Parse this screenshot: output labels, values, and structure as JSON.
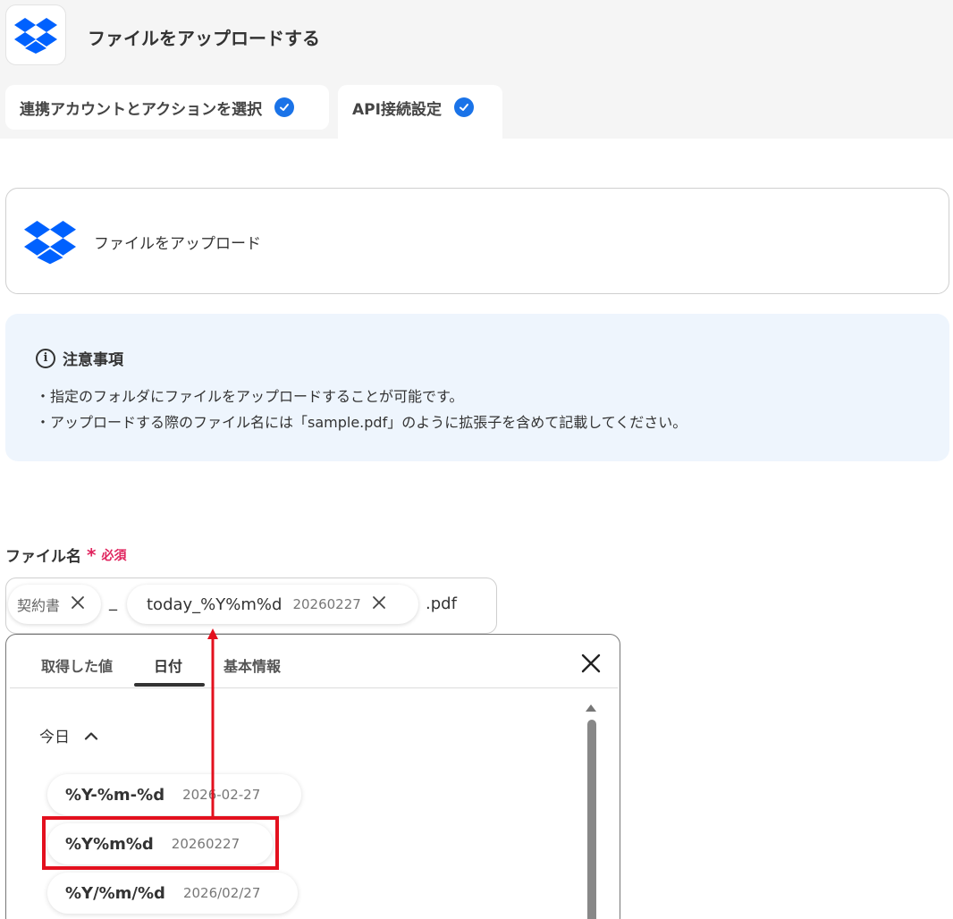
{
  "header": {
    "title": "ファイルをアップロードする",
    "app_icon": "dropbox-icon"
  },
  "steps": [
    {
      "label": "連携アカウントとアクションを選択",
      "status": "complete"
    },
    {
      "label": "API接続設定",
      "status": "complete"
    }
  ],
  "action": {
    "label": "ファイルをアップロード",
    "icon": "dropbox-icon"
  },
  "notice": {
    "title": "注意事項",
    "lines": [
      "・指定のフォルダにファイルをアップロードすることが可能です。",
      "・アップロードする際のファイル名には「sample.pdf」のように拡張子を含めて記載してください。"
    ]
  },
  "file_name_field": {
    "label": "ファイル名",
    "required_mark": "*",
    "required_text": "必須",
    "parts": {
      "chip1_text": "契約書",
      "separator": "_",
      "chip2_expression": "today_%Y%m%d",
      "chip2_preview": "20260227",
      "extension": ".pdf"
    }
  },
  "picker": {
    "tabs": [
      "取得した値",
      "日付",
      "基本情報"
    ],
    "active_tab": "日付",
    "section": {
      "title": "今日",
      "options": [
        {
          "format": "%Y-%m-%d",
          "preview": "2026-02-27"
        },
        {
          "format": "%Y%m%d",
          "preview": "20260227"
        },
        {
          "format": "%Y/%m/%d",
          "preview": "2026/02/27"
        }
      ]
    }
  },
  "annotation": {
    "highlight_color": "#e3101e",
    "highlighted_option": "%Y%m%d"
  },
  "colors": {
    "accent": "#1a73e8",
    "dropbox": "#0061fe",
    "required": "#e0245e",
    "notice_bg": "#eef5fd"
  }
}
